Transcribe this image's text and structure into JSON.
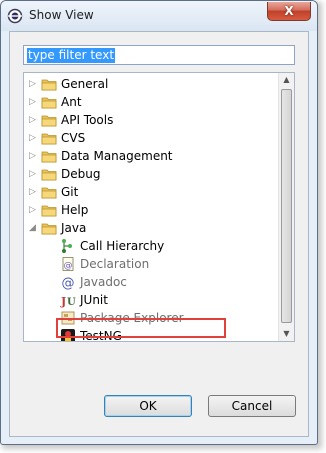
{
  "window": {
    "title": "Show View",
    "close_label": "X"
  },
  "filter": {
    "value": "type filter text"
  },
  "tree": {
    "categories": [
      {
        "label": "General",
        "icon": "folder-icon",
        "expanded": false
      },
      {
        "label": "Ant",
        "icon": "folder-icon",
        "expanded": false
      },
      {
        "label": "API Tools",
        "icon": "folder-icon",
        "expanded": false
      },
      {
        "label": "CVS",
        "icon": "folder-icon",
        "expanded": false
      },
      {
        "label": "Data Management",
        "icon": "folder-icon",
        "expanded": false
      },
      {
        "label": "Debug",
        "icon": "folder-icon",
        "expanded": false
      },
      {
        "label": "Git",
        "icon": "folder-icon",
        "expanded": false
      },
      {
        "label": "Help",
        "icon": "folder-icon",
        "expanded": false
      },
      {
        "label": "Java",
        "icon": "folder-icon",
        "expanded": true
      }
    ],
    "java_children": [
      {
        "label": "Call Hierarchy",
        "icon": "call-hierarchy-icon"
      },
      {
        "label": "Declaration",
        "icon": "declaration-icon"
      },
      {
        "label": "Javadoc",
        "icon": "javadoc-icon"
      },
      {
        "label": "JUnit",
        "icon": "junit-icon",
        "highlighted": true
      },
      {
        "label": "Package Explorer",
        "icon": "package-explorer-icon"
      },
      {
        "label": "TestNG",
        "icon": "testng-icon"
      }
    ]
  },
  "buttons": {
    "ok_label": "OK",
    "cancel_label": "Cancel"
  }
}
